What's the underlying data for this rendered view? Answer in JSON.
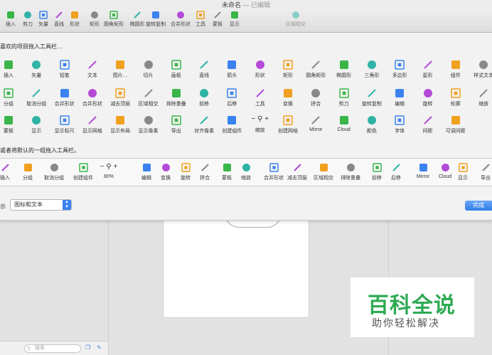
{
  "window": {
    "title": "未命名",
    "title_suffix": "— 已编辑"
  },
  "toolbar": [
    {
      "id": "insert",
      "label": "插入",
      "icon": "plus-icon"
    },
    {
      "id": "scissors",
      "label": "剪刀",
      "icon": "scissors-icon"
    },
    {
      "id": "vector",
      "label": "矢量",
      "icon": "vector-pen-icon"
    },
    {
      "id": "line",
      "label": "直线",
      "icon": "line-icon"
    },
    {
      "id": "shape",
      "label": "形状",
      "icon": "shapes-icon"
    },
    {
      "id": "rect",
      "label": "矩形",
      "icon": "rectangle-icon"
    },
    {
      "id": "roundrect",
      "label": "圆角矩形",
      "icon": "rounded-rect-icon"
    },
    {
      "id": "ellipse",
      "label": "椭圆形",
      "icon": "ellipse-icon"
    },
    {
      "id": "rotatecopy",
      "label": "旋转复制",
      "icon": "rotate-copy-icon"
    },
    {
      "id": "combine",
      "label": "合并形状",
      "icon": "combine-icon"
    },
    {
      "id": "tools",
      "label": "工具",
      "icon": "tools-icon"
    },
    {
      "id": "mask",
      "label": "蒙板",
      "icon": "mask-icon"
    },
    {
      "id": "display",
      "label": "显示",
      "icon": "display-icon"
    },
    {
      "id": "area",
      "label": "区域相交",
      "icon": "intersect-icon"
    }
  ],
  "sheet": {
    "favorites_title": "喜欢的项目拖入工具栏…",
    "rows": [
      [
        "插入",
        "矢量",
        "铅笔",
        "文本",
        "图片…",
        "切片",
        "画板",
        "直线",
        "箭头",
        "形状",
        "矩形",
        "圆角矩形",
        "椭圆形",
        "三角形",
        "多边形",
        "星形",
        "组件",
        "样式文本"
      ],
      [
        "分组",
        "取消分组",
        "合并形状",
        "合并形状",
        "减去顶层",
        "区域相交",
        "排除重叠",
        "前移",
        "后移",
        "工具",
        "变换",
        "拼合",
        "剪刀",
        "旋转复制",
        "编辑",
        "旋转",
        "轮廓",
        "缩放"
      ],
      [
        "蒙板",
        "显示",
        "显示标尺",
        "显示网格",
        "显示布局",
        "显示像素",
        "导出",
        "对齐像素",
        "创建组件",
        "缩放",
        "创建网格",
        "Mirror",
        "Cloud",
        "颜色",
        "字体",
        "间距",
        "可调间距"
      ]
    ],
    "default_title": "或者将默认的一组拖入工具栏。",
    "default_items": [
      "插入",
      "分组",
      "取消分组",
      "创建组件",
      "80%",
      "编辑",
      "变换",
      "旋转",
      "拼合",
      "蒙板",
      "缩放",
      "合并形状",
      "减去顶层",
      "区域相交",
      "排除重叠",
      "前移",
      "后移",
      "Mirror",
      "Cloud",
      "显示",
      "导出"
    ],
    "zoom_minus": "−",
    "zoom_plus": "+",
    "show_label": "示",
    "show_value": "图标和文本",
    "done": "完成"
  },
  "sidebar": {
    "search_placeholder": "搜索"
  },
  "watermark": {
    "title": "百科全说",
    "subtitle": "助你轻松解决"
  },
  "colors": {
    "green": "#39b54a",
    "blue": "#3b82f0",
    "purple": "#b44bd8",
    "teal": "#2fb3a6",
    "orange": "#f0a020"
  }
}
